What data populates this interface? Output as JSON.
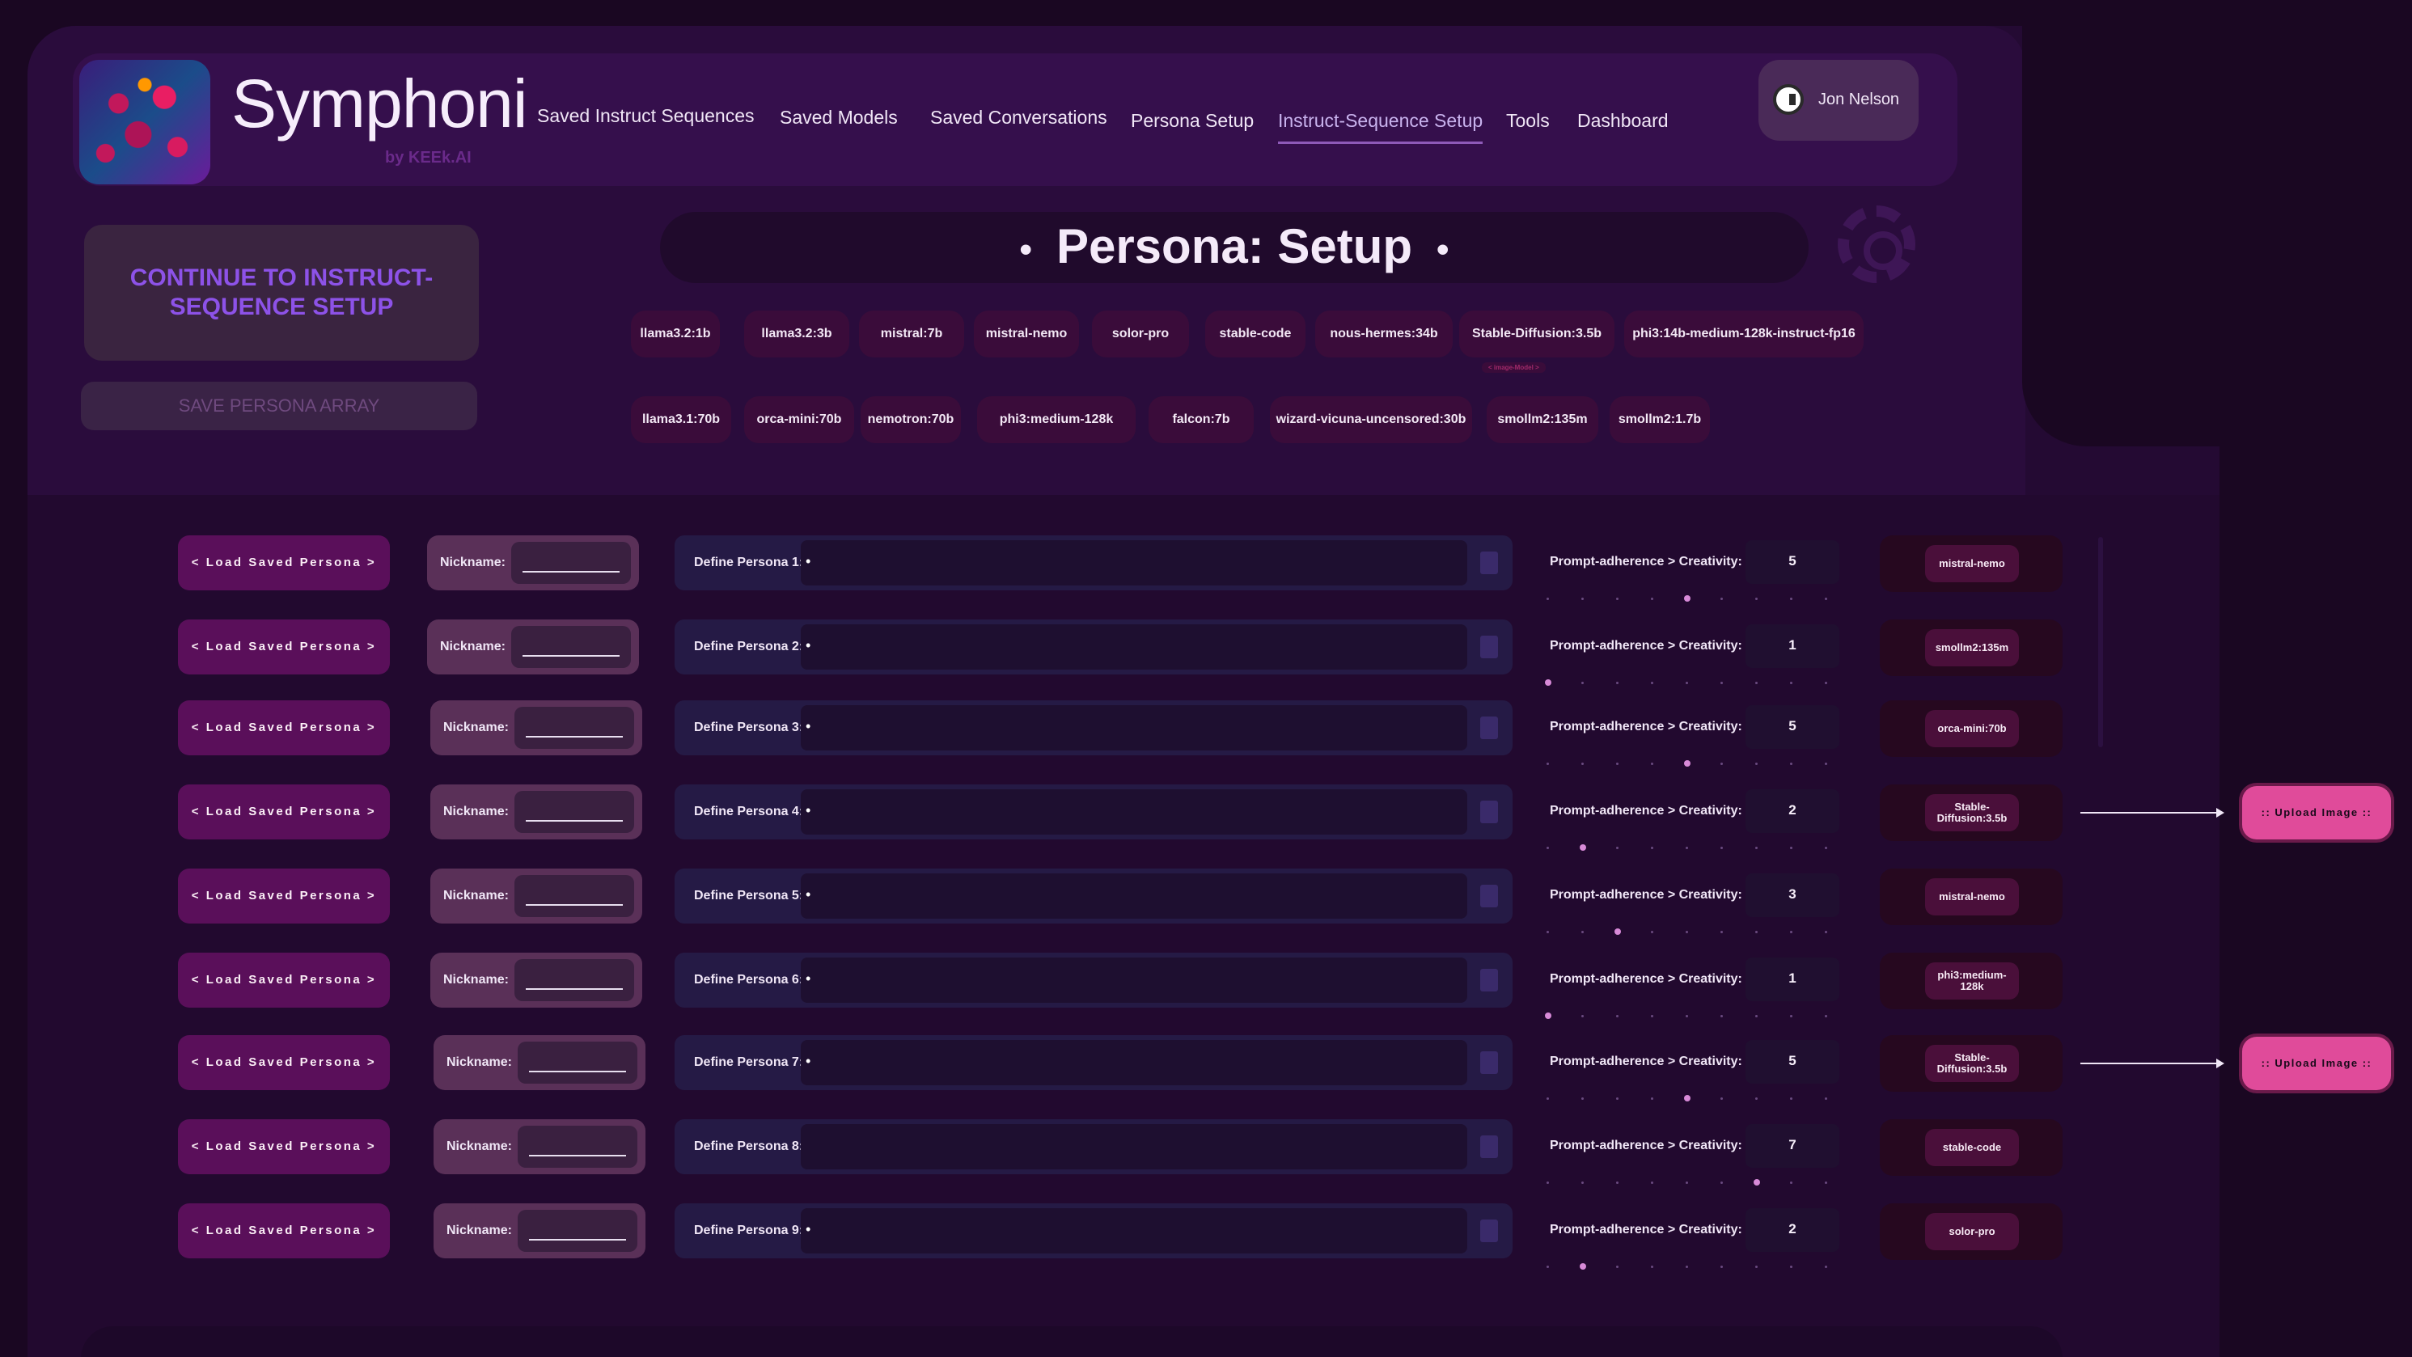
{
  "app": {
    "name": "Symphoni",
    "byline": "by KEEk.AI"
  },
  "nav": [
    "Saved Instruct Sequences",
    "Saved Models",
    "Saved Conversations",
    "Persona Setup",
    "Instruct-Sequence Setup",
    "Tools",
    "Dashboard"
  ],
  "nav_active": "Instruct-Sequence Setup",
  "user": {
    "name": "Jon Nelson"
  },
  "left_panel": {
    "continue_label": "CONTINUE TO INSTRUCT-SEQUENCE SETUP",
    "save_label": "SAVE PERSONA ARRAY"
  },
  "title": {
    "text": "Persona: Setup",
    "bullet": "•"
  },
  "models_row1": [
    "llama3.2:1b",
    "llama3.2:3b",
    "mistral:7b",
    "mistral-nemo",
    "solor-pro",
    "stable-code",
    "nous-hermes:34b",
    "Stable-Diffusion:3.5b",
    "phi3:14b-medium-128k-instruct-fp16"
  ],
  "models_row2": [
    "llama3.1:70b",
    "orca-mini:70b",
    "nemotron:70b",
    "phi3:medium-128k",
    "falcon:7b",
    "wizard-vicuna-uncensored:30b",
    "smollm2:135m",
    "smollm2:1.7b"
  ],
  "image_model_tag": "< image-Model >",
  "row_common": {
    "load_label": "< Load Saved Persona >",
    "nickname_label": "Nickname:",
    "slider_label": "Prompt-adherence  >  Creativity:",
    "upload_label": ":: Upload Image ::"
  },
  "personas": [
    {
      "define_label": "Define Persona 1:",
      "text": "•",
      "creativity": 5,
      "model": "mistral-nemo",
      "upload": false
    },
    {
      "define_label": "Define Persona 2:",
      "text": "•",
      "creativity": 1,
      "model": "smollm2:135m",
      "upload": false
    },
    {
      "define_label": "Define Persona 3:",
      "text": "•",
      "creativity": 5,
      "model": "orca-mini:70b",
      "upload": false
    },
    {
      "define_label": "Define Persona 4:",
      "text": "•",
      "creativity": 2,
      "model": "Stable-Diffusion:3.5b",
      "upload": true
    },
    {
      "define_label": "Define Persona 5:",
      "text": "•",
      "creativity": 3,
      "model": "mistral-nemo",
      "upload": false
    },
    {
      "define_label": "Define Persona 6:",
      "text": "•",
      "creativity": 1,
      "model": "phi3:medium-128k",
      "upload": false
    },
    {
      "define_label": "Define Persona 7:",
      "text": "•",
      "creativity": 5,
      "model": "Stable-Diffusion:3.5b",
      "upload": true
    },
    {
      "define_label": "Define Persona 8:",
      "text": "",
      "creativity": 7,
      "model": "stable-code",
      "upload": false
    },
    {
      "define_label": "Define Persona 9:",
      "text": "•",
      "creativity": 2,
      "model": "solor-pro",
      "upload": false
    }
  ],
  "slider_max": 9
}
